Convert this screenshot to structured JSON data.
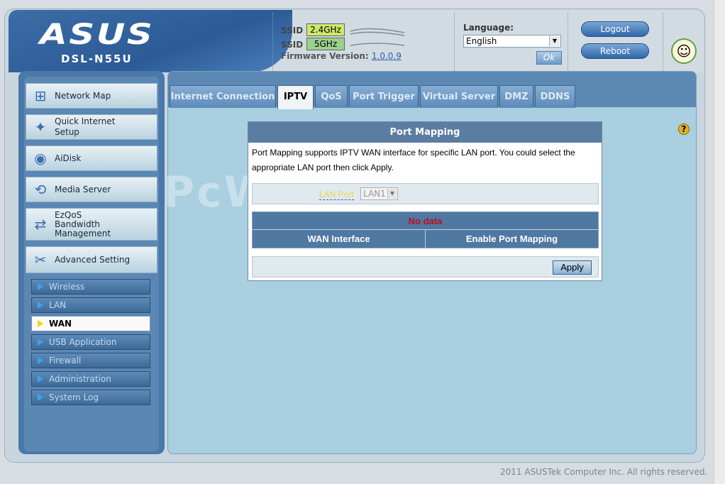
{
  "header": {
    "logo": "ASUS",
    "model": "DSL-N55U",
    "ssid_label": "SSID",
    "bands": [
      "2.4GHz",
      "5GHz"
    ],
    "band_colors": [
      "#cde86a",
      "#9ad18c"
    ],
    "firmware_label": "Firmware Version:",
    "firmware_value": "1.0.0.9",
    "language_label": "Language:",
    "language_value": "English",
    "ok_label": "Ok",
    "logout_label": "Logout",
    "reboot_label": "Reboot",
    "avatar_icon": "user-avatar-icon"
  },
  "sidebar": {
    "items": [
      {
        "label": "Network Map",
        "icon": "network-map-icon"
      },
      {
        "label": "Quick Internet Setup",
        "icon": "magic-wand-icon"
      },
      {
        "label": "AiDisk",
        "icon": "disk-icon"
      },
      {
        "label": "Media Server",
        "icon": "media-icon"
      },
      {
        "label": "EzQoS Bandwidth Management",
        "icon": "qos-icon"
      },
      {
        "label": "Advanced Setting",
        "icon": "tools-icon"
      }
    ],
    "sub_items": [
      {
        "label": "Wireless"
      },
      {
        "label": "LAN"
      },
      {
        "label": "WAN",
        "active": true
      },
      {
        "label": "USB Application"
      },
      {
        "label": "Firewall"
      },
      {
        "label": "Administration"
      },
      {
        "label": "System Log"
      }
    ]
  },
  "tabs": [
    "Internet Connection",
    "IPTV",
    "QoS",
    "Port Trigger",
    "Virtual Server",
    "DMZ",
    "DDNS"
  ],
  "active_tab": "IPTV",
  "panel": {
    "title": "Port Mapping",
    "description": "Port Mapping supports IPTV WAN interface for specific LAN port. You could select the appropriate LAN port then click Apply.",
    "lan_port_label": "LAN Port",
    "lan_port_value": "LAN1",
    "no_data": "No data",
    "columns": [
      "WAN Interface",
      "Enable Port Mapping"
    ],
    "apply_label": "Apply"
  },
  "watermark": "PcWinTech.com",
  "footer": "2011 ASUSTek Computer Inc. All rights reserved."
}
